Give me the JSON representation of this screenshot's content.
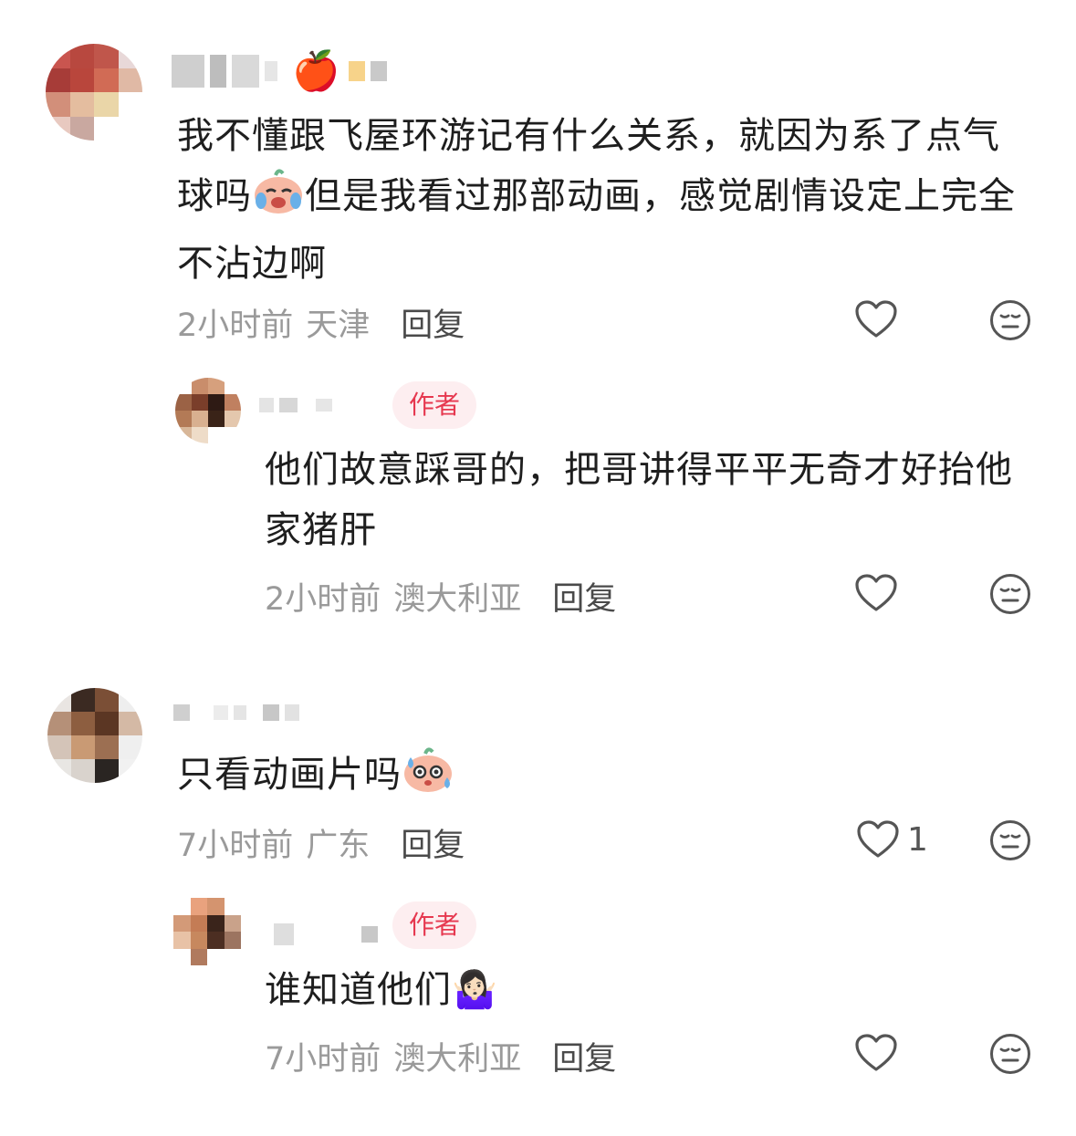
{
  "comments": [
    {
      "text_1": "我不懂跟飞屋环游记有什么关系，就因为系了点气",
      "text_2a": "球吗",
      "text_2b": "但是我看过那部动画，感觉剧情设定上完全",
      "text_3": "不沾边啊",
      "time": "2小时前",
      "location": "天津",
      "reply_label": "回复",
      "name_emoji": "🍎",
      "inline_emoji": "crying-face-sticker",
      "replies": [
        {
          "author_tag": "作者",
          "text_1": "他们故意踩哥的，把哥讲得平平无奇才好抬他",
          "text_2": "家猪肝",
          "time": "2小时前",
          "location": "澳大利亚",
          "reply_label": "回复"
        }
      ]
    },
    {
      "text_1": "只看动画片吗",
      "inline_emoji": "sweating-face-sticker",
      "time": "7小时前",
      "location": "广东",
      "reply_label": "回复",
      "likes": "1",
      "replies": [
        {
          "author_tag": "作者",
          "text_1": "谁知道他们",
          "emoji": "🤷🏻‍♀️",
          "time": "7小时前",
          "location": "澳大利亚",
          "reply_label": "回复"
        }
      ]
    }
  ],
  "colors": {
    "author_tag_bg": "#fdeef0",
    "author_tag_text": "#e6384f",
    "meta_text": "#9a9a9a",
    "icon_stroke": "#555555"
  }
}
